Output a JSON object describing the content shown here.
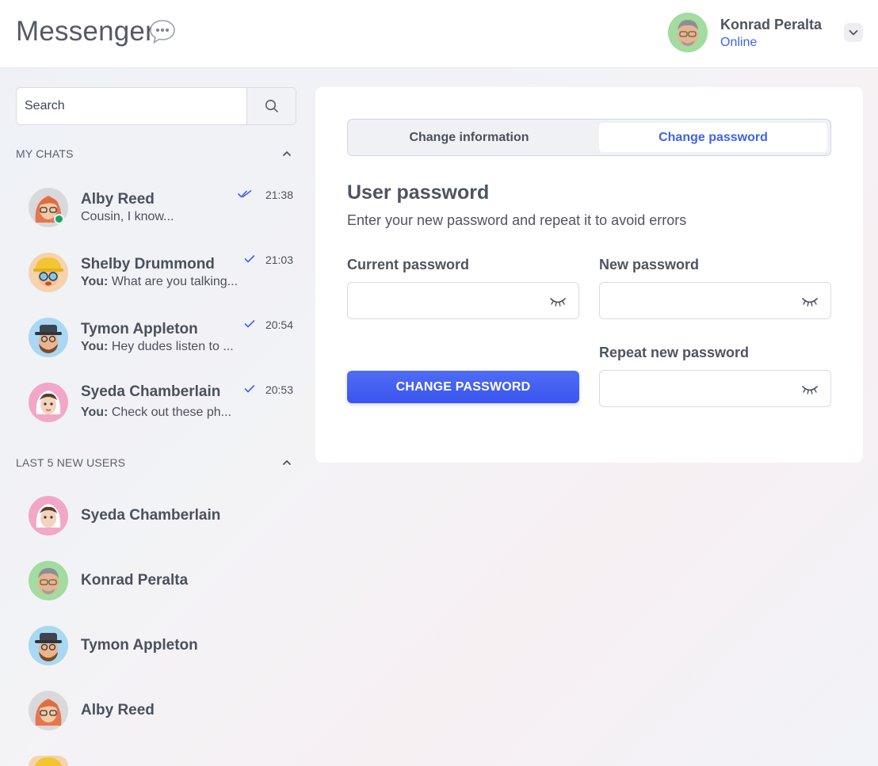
{
  "app": {
    "title": "Messenger",
    "title_icon": "speech-bubble-icon"
  },
  "user": {
    "name": "Konrad Peralta",
    "status": "Online",
    "avatar": "memoji-konrad"
  },
  "search": {
    "placeholder": "Search",
    "icon": "search-icon"
  },
  "my_chats": {
    "title": "MY CHATS",
    "items": [
      {
        "name": "Alby Reed",
        "you_prefix": "",
        "message": "Cousin, I know...",
        "time": "21:38",
        "status_icon": "double-check-icon",
        "online": true
      },
      {
        "name": "Shelby Drummond",
        "you_prefix": "You:",
        "message": "What are you talking...",
        "time": "21:03",
        "status_icon": "check-icon",
        "online": false
      },
      {
        "name": "Tymon Appleton",
        "you_prefix": "You:",
        "message": "Hey dudes listen to ...",
        "time": "20:54",
        "status_icon": "check-icon",
        "online": false
      },
      {
        "name": "Syeda Chamberlain",
        "you_prefix": "You:",
        "message": "Check out these ph...",
        "time": "20:53",
        "status_icon": "check-icon",
        "online": false
      }
    ]
  },
  "new_users": {
    "title": "LAST 5 NEW USERS",
    "items": [
      {
        "name": "Syeda Chamberlain"
      },
      {
        "name": "Konrad Peralta"
      },
      {
        "name": "Tymon Appleton"
      },
      {
        "name": "Alby Reed"
      }
    ]
  },
  "panel": {
    "tabs": [
      {
        "label": "Change information",
        "active": false
      },
      {
        "label": "Change password",
        "active": true
      }
    ],
    "title": "User password",
    "subtitle": "Enter your new password and repeat it to avoid errors",
    "fields": {
      "current": {
        "label": "Current password",
        "value": ""
      },
      "new": {
        "label": "New password",
        "value": ""
      },
      "repeat": {
        "label": "Repeat new password",
        "value": ""
      }
    },
    "submit_label": "CHANGE PASSWORD"
  },
  "colors": {
    "accent": "#3d63f0",
    "online": "#15a36a",
    "text": "#4b505d"
  }
}
